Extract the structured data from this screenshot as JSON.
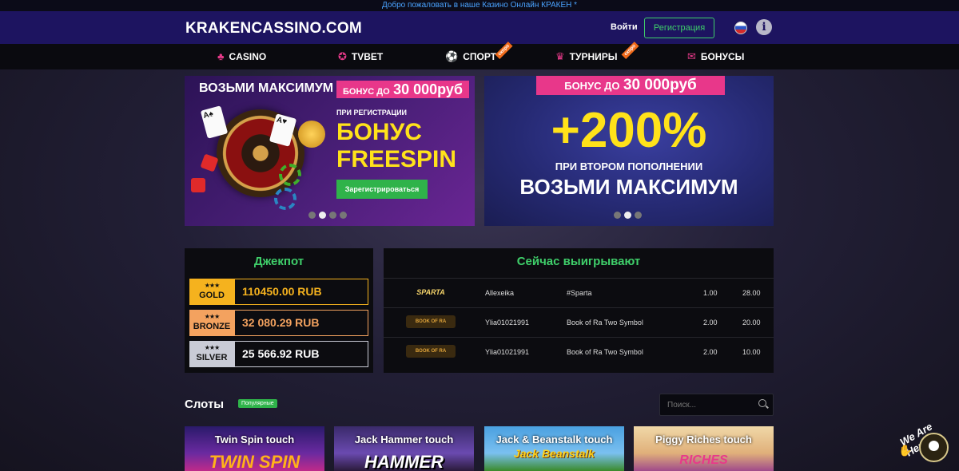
{
  "topbar": {
    "welcome": "Добро пожаловать в наше Казино Онлайн КРАКЕН *"
  },
  "header": {
    "logo": "KRAKENCASSINO.COM",
    "login": "Войти",
    "register": "Регистрация"
  },
  "nav": {
    "items": [
      {
        "label": "CASINO",
        "icon": "♣"
      },
      {
        "label": "TVBET",
        "icon": "✪"
      },
      {
        "label": "СПОРТ",
        "icon": "⚽",
        "tag": "скоро"
      },
      {
        "label": "ТУРНИРЫ",
        "icon": "♛",
        "tag": "скоро"
      },
      {
        "label": "БОНУСЫ",
        "icon": "✉"
      }
    ]
  },
  "banner_left": {
    "title": "ВОЗЬМИ МАКСИМУМ",
    "bonus_prefix": "БОНУС ДО",
    "bonus_amount": "30 000руб",
    "sub": "ПРИ РЕГИСТРАЦИИ",
    "bonus_line1": "БОНУС",
    "bonus_line2": "FREESPIN",
    "cta": "Зарегистрироваться"
  },
  "banner_right": {
    "bonus_prefix": "БОНУС ДО",
    "bonus_amount": "30 000руб",
    "big": "+200%",
    "sub": "ПРИ ВТОРОМ ПОПОЛНЕНИИ",
    "main": "ВОЗЬМИ МАКСИМУМ"
  },
  "jackpot": {
    "title": "Джекпот",
    "rows": [
      {
        "label": "GOLD",
        "value": "110450.00 RUB",
        "color": "#f5b21e"
      },
      {
        "label": "BRONZE",
        "value": "32 080.29 RUB",
        "color": "#f3a25f"
      },
      {
        "label": "SILVER",
        "value": "25 566.92 RUB",
        "color": "#c9cbd6"
      }
    ]
  },
  "winners": {
    "title": "Сейчас выигрывают",
    "rows": [
      {
        "logo": "SPARTA",
        "user": "Allexeika",
        "game": "#Sparta",
        "bet": "1.00",
        "win": "28.00"
      },
      {
        "logo": "BOOK OF RA",
        "user": "Ylia01021991",
        "game": "Book of Ra Two Symbol",
        "bet": "2.00",
        "win": "20.00"
      },
      {
        "logo": "BOOK OF RA",
        "user": "Ylia01021991",
        "game": "Book of Ra Two Symbol",
        "bet": "2.00",
        "win": "10.00"
      }
    ]
  },
  "slots": {
    "title": "Слоты",
    "badge": "Популярные",
    "search_placeholder": "Поиск...",
    "cards": [
      {
        "title": "Twin Spin touch",
        "art": "TWIN SPIN"
      },
      {
        "title": "Jack Hammer touch",
        "art": "HAMMER"
      },
      {
        "title": "Jack & Beanstalk touch",
        "art": "Jack Beanstalk"
      },
      {
        "title": "Piggy Riches touch",
        "art": "RICHES"
      }
    ]
  },
  "chat": {
    "label": "We Are Here!"
  }
}
